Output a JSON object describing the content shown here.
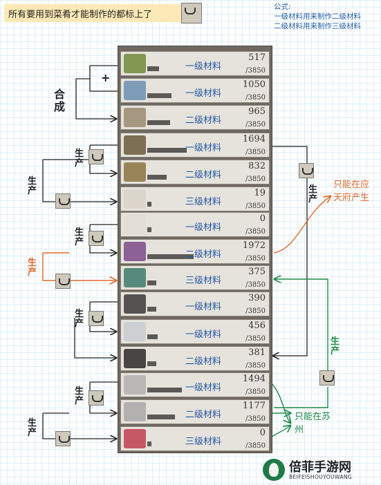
{
  "header": {
    "note": "所有要用到菜肴才能制作的都标上了"
  },
  "formula": {
    "title": "公式:",
    "line1": "一级材料用来制作二级材料",
    "line2": "二级材料用来制作三级材料"
  },
  "labels": {
    "plus": "+",
    "compose": "合成",
    "produce": "生产",
    "only_yingtian": "只能在应天府产生",
    "only_suzhou": "只能在苏州"
  },
  "materials": [
    {
      "icon": "green-herb-bundle-icon",
      "level": "一级材料",
      "count": "517",
      "max": "/3850",
      "fill": 0.134
    },
    {
      "icon": "blue-fish-icon",
      "level": "一级材料",
      "count": "1050",
      "max": "/3850",
      "fill": 0.273
    },
    {
      "icon": "fish-bowl-icon",
      "level": "二级材料",
      "count": "965",
      "max": "/3850",
      "fill": 0.251
    },
    {
      "icon": "timber-logs-icon",
      "level": "一级材料",
      "count": "1694",
      "max": "/3850",
      "fill": 0.44
    },
    {
      "icon": "cut-planks-icon",
      "level": "二级材料",
      "count": "832",
      "max": "/3850",
      "fill": 0.216
    },
    {
      "icon": "paper-scroll-icon",
      "level": "三级材料",
      "count": "19",
      "max": "/3850",
      "fill": 0.005
    },
    {
      "icon": "cotton-boll-icon",
      "level": "一级材料",
      "count": "0",
      "max": "/3850",
      "fill": 0
    },
    {
      "icon": "purple-cloth-bolts-icon",
      "level": "二级材料",
      "count": "1972",
      "max": "/3850",
      "fill": 0.512
    },
    {
      "icon": "green-garment-icon",
      "level": "三级材料",
      "count": "375",
      "max": "/3850",
      "fill": 0.097
    },
    {
      "icon": "coal-lumps-icon",
      "level": "一级材料",
      "count": "390",
      "max": "/3850",
      "fill": 0.101
    },
    {
      "icon": "salt-sacks-icon",
      "level": "一级材料",
      "count": "456",
      "max": "/3850",
      "fill": 0.118
    },
    {
      "icon": "ink-sticks-icon",
      "level": "二级材料",
      "count": "381",
      "max": "/3850",
      "fill": 0.099
    },
    {
      "icon": "silk-stack-icon",
      "level": "一级材料",
      "count": "1494",
      "max": "/3850",
      "fill": 0.388
    },
    {
      "icon": "silk-rolls-icon",
      "level": "二级材料",
      "count": "1177",
      "max": "/3850",
      "fill": 0.306
    },
    {
      "icon": "red-embroidery-icon",
      "level": "三级材料",
      "count": "0",
      "max": "/3850",
      "fill": 0
    }
  ],
  "watermark": {
    "name": "倍菲手游网",
    "sub": "BEIFEISHOUYOUWANG"
  },
  "colors": {
    "level_text": "#2457a3",
    "orange_note": "#e06a30",
    "green_note": "#1f8a4a",
    "highlight": "#fde9b6"
  }
}
